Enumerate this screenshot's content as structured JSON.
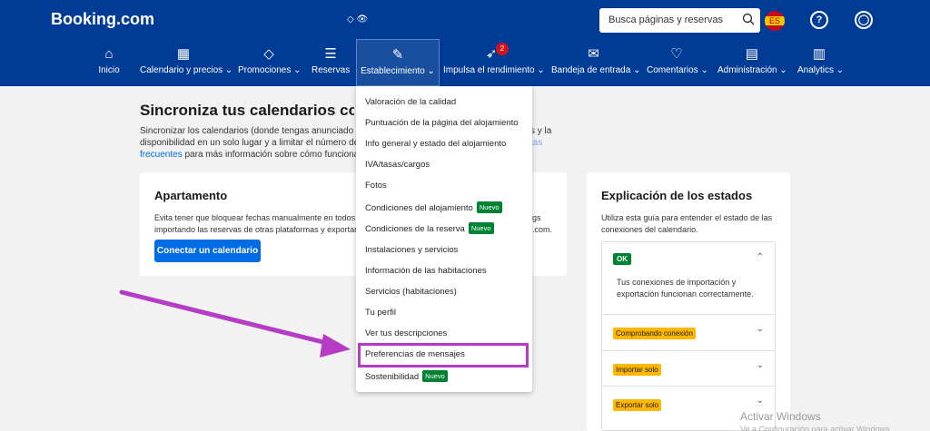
{
  "header": {
    "logo": "Booking.com",
    "account_indicator": "◇ 👁",
    "search_placeholder": "Busca páginas y reservas",
    "flag_label": "ES",
    "help_label": "?",
    "user_label": "◯"
  },
  "nav": {
    "items": [
      {
        "label": "Inicio",
        "icon": "home-icon",
        "glyph": "⌂"
      },
      {
        "label": "Calendario y precios ⌄",
        "icon": "calendar-icon",
        "glyph": "▦"
      },
      {
        "label": "Promociones ⌄",
        "icon": "tag-icon",
        "glyph": "◇"
      },
      {
        "label": "Reservas",
        "icon": "list-icon",
        "glyph": "☰"
      },
      {
        "label": "Establecimiento ⌄",
        "icon": "pencil-icon",
        "glyph": "✎"
      },
      {
        "label": "Impulsa el rendimiento ⌄",
        "icon": "rocket-icon",
        "glyph": "➶",
        "badge": "2"
      },
      {
        "label": "Bandeja de entrada ⌄",
        "icon": "mail-icon",
        "glyph": "✉"
      },
      {
        "label": "Comentarios ⌄",
        "icon": "heart-icon",
        "glyph": "♡"
      },
      {
        "label": "Administración ⌄",
        "icon": "document-icon",
        "glyph": "▤"
      },
      {
        "label": "Analytics ⌄",
        "icon": "bar-chart-icon",
        "glyph": "▥"
      }
    ]
  },
  "page": {
    "title": "Sincroniza tus calendarios con Ai",
    "intro": {
      "line1": "Sincronizar los calendarios (donde tengas anunciado el aloja",
      "line2": "disponibilidad en un solo lugar y a limitar el número de ove",
      "link": "frecuentes",
      "line3": "para más información sobre cómo funciona."
    },
    "intro_right": {
      "line1": "s y la",
      "link": "tas"
    }
  },
  "card_apartamento": {
    "title": "Apartamento",
    "line1": "Evita tener que bloquear fechas manualmente en todos",
    "line2": "importando las reservas de otras plataformas y exportan",
    "right1": "gs",
    "right2": ".com.",
    "button": "Conectar un calendario"
  },
  "card_estados": {
    "title": "Explicación de los estados",
    "description": "Utiliza esta guía para entender el estado de las conexiones del calendario.",
    "ok_tag": "OK",
    "ok_text": "Tus conexiones de importación y exportación funcionan correctamente.",
    "status_tags": [
      "Comprobando conexión",
      "Importar solo",
      "Exportar solo"
    ],
    "chevron_up": "⌃",
    "chevron_down": "⌄"
  },
  "dropdown": {
    "items": [
      {
        "label": "Valoración de la calidad",
        "badge": ""
      },
      {
        "label": "Puntuación de la página del alojamiento",
        "badge": ""
      },
      {
        "label": "Info general y estado del alojamiento",
        "badge": ""
      },
      {
        "label": "IVA/tasas/cargos",
        "badge": ""
      },
      {
        "label": "Fotos",
        "badge": ""
      },
      {
        "label": "Condiciones del alojamiento",
        "badge": "Nuevo"
      },
      {
        "label": "Condiciones de la reserva",
        "badge": "Nuevo"
      },
      {
        "label": "Instalaciones y servicios",
        "badge": ""
      },
      {
        "label": "Información de las habitaciones",
        "badge": ""
      },
      {
        "label": "Servicios (habitaciones)",
        "badge": ""
      },
      {
        "label": "Tu perfil",
        "badge": ""
      },
      {
        "label": "Ver tus descripciones",
        "badge": ""
      },
      {
        "label": "Preferencias de mensajes",
        "badge": ""
      },
      {
        "label": "Sostenibilidad",
        "badge": "Nuevo"
      }
    ]
  },
  "watermark": {
    "line1": "Activar Windows",
    "line2": "Ve a Configuración para activar Windows."
  },
  "colors": {
    "brand": "#003b95",
    "accent": "#006ce4",
    "highlight": "#b53cc4",
    "success": "#008234",
    "warning": "#ffb700"
  }
}
